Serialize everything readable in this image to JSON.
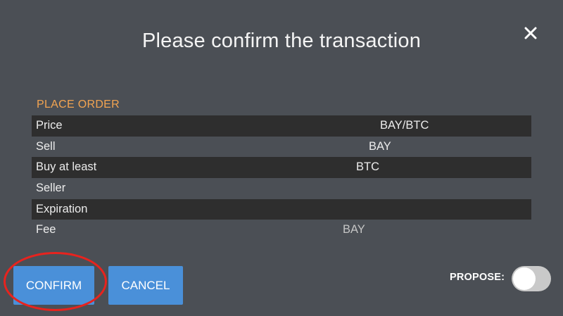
{
  "dialog": {
    "title": "Please confirm the transaction",
    "close_icon": "close-icon"
  },
  "order": {
    "section_title": "PLACE ORDER",
    "rows": [
      {
        "label": "Price",
        "value": "BAY/BTC"
      },
      {
        "label": "Sell",
        "value": "BAY"
      },
      {
        "label": "Buy at least",
        "value": "BTC"
      },
      {
        "label": "Seller",
        "value": ""
      },
      {
        "label": "Expiration",
        "value": ""
      },
      {
        "label": "Fee",
        "value": "BAY"
      }
    ]
  },
  "actions": {
    "confirm_label": "CONFIRM",
    "cancel_label": "CANCEL",
    "propose_label": "PROPOSE:",
    "propose_enabled": false
  },
  "colors": {
    "background": "#4b4f55",
    "accent": "#f3a451",
    "button": "#4a90d9",
    "highlight": "#e8231e"
  }
}
